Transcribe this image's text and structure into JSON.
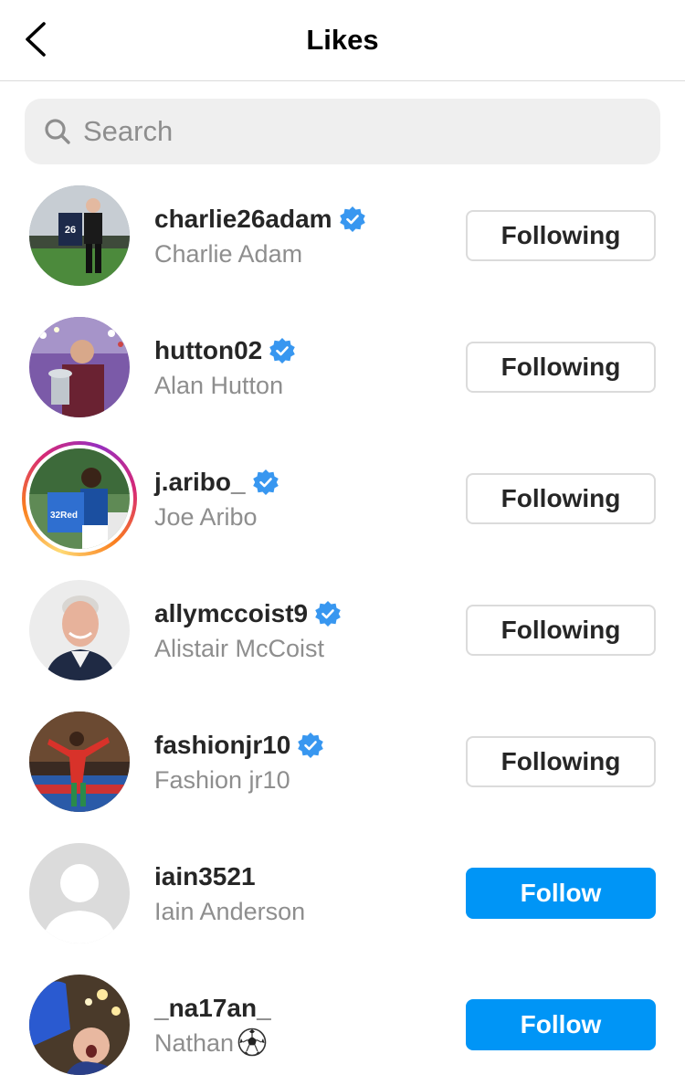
{
  "header": {
    "title": "Likes",
    "back_icon": "chevron-left-icon"
  },
  "search": {
    "placeholder": "Search",
    "value": "",
    "icon": "search-icon"
  },
  "colors": {
    "accent": "#0095f6",
    "verified": "#3897f0",
    "secondary_text": "#8e8e8e",
    "border": "#dbdbdb",
    "search_bg": "#efefef"
  },
  "users": [
    {
      "username": "charlie26adam",
      "full_name": "Charlie Adam",
      "verified": true,
      "button": "Following",
      "story_ring": false,
      "name_emoji": ""
    },
    {
      "username": "hutton02",
      "full_name": "Alan Hutton",
      "verified": true,
      "button": "Following",
      "story_ring": false,
      "name_emoji": ""
    },
    {
      "username": "j.aribo_",
      "full_name": "Joe Aribo",
      "verified": true,
      "button": "Following",
      "story_ring": true,
      "name_emoji": ""
    },
    {
      "username": "allymccoist9",
      "full_name": "Alistair McCoist",
      "verified": true,
      "button": "Following",
      "story_ring": false,
      "name_emoji": ""
    },
    {
      "username": "fashionjr10",
      "full_name": "Fashion jr10",
      "verified": true,
      "button": "Following",
      "story_ring": false,
      "name_emoji": ""
    },
    {
      "username": "iain3521",
      "full_name": "Iain Anderson",
      "verified": false,
      "button": "Follow",
      "story_ring": false,
      "name_emoji": ""
    },
    {
      "username": "_na17an_",
      "full_name": "Nathan",
      "verified": false,
      "button": "Follow",
      "story_ring": false,
      "name_emoji": "soccer-ball-emoji"
    }
  ]
}
